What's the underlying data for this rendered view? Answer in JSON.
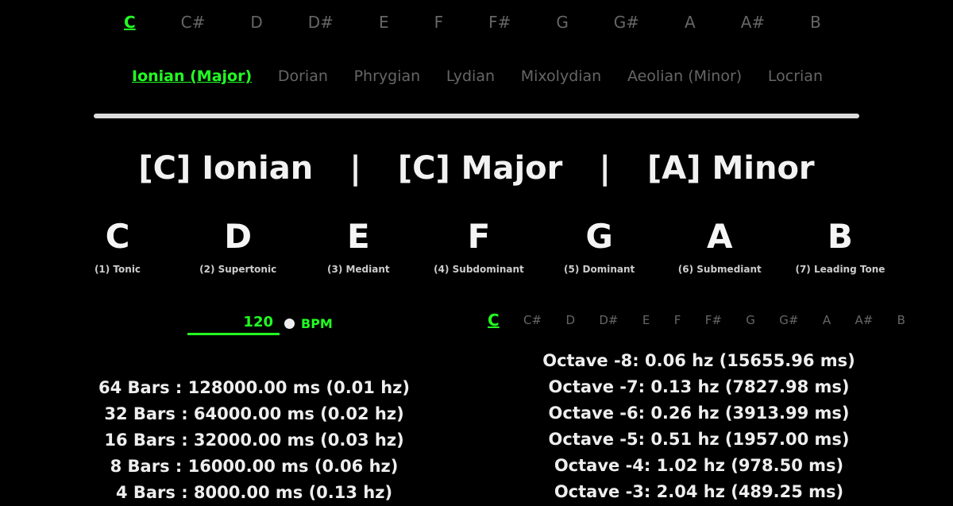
{
  "keys": [
    "C",
    "C#",
    "D",
    "D#",
    "E",
    "F",
    "F#",
    "G",
    "G#",
    "A",
    "A#",
    "B"
  ],
  "modes": [
    "Ionian (Major)",
    "Dorian",
    "Phrygian",
    "Lydian",
    "Mixolydian",
    "Aeolian (Minor)",
    "Locrian"
  ],
  "title": {
    "part1": "[C] Ionian",
    "separator": "|",
    "part2": "[C] Major",
    "part3": "[A] Minor"
  },
  "notes": [
    {
      "letter": "C",
      "degree": "(1) Tonic"
    },
    {
      "letter": "D",
      "degree": "(2) Supertonic"
    },
    {
      "letter": "E",
      "degree": "(3) Mediant"
    },
    {
      "letter": "F",
      "degree": "(4) Subdominant"
    },
    {
      "letter": "G",
      "degree": "(5) Dominant"
    },
    {
      "letter": "A",
      "degree": "(6) Submediant"
    },
    {
      "letter": "B",
      "degree": "(7) Leading Tone"
    }
  ],
  "bpm": {
    "value": "120",
    "unit": "BPM"
  },
  "bars": [
    "64 Bars : 128000.00 ms (0.01 hz)",
    "32 Bars : 64000.00 ms (0.02 hz)",
    "16 Bars : 32000.00 ms (0.03 hz)",
    "8 Bars : 16000.00 ms (0.06 hz)",
    "4 Bars : 8000.00 ms (0.13 hz)"
  ],
  "osc_keys": [
    "C",
    "C#",
    "D",
    "D#",
    "E",
    "F",
    "F#",
    "G",
    "G#",
    "A",
    "A#",
    "B"
  ],
  "octaves": [
    "Octave -8: 0.06 hz (15655.96 ms)",
    "Octave -7: 0.13 hz (7827.98 ms)",
    "Octave -6: 0.26 hz (3913.99 ms)",
    "Octave -5: 0.51 hz (1957.00 ms)",
    "Octave -4: 1.02 hz (978.50 ms)",
    "Octave -3: 2.04 hz (489.25 ms)"
  ],
  "colors": {
    "accent": "#22ff22",
    "background": "#000000",
    "text": "#eeeeee",
    "inactive": "#666666"
  }
}
